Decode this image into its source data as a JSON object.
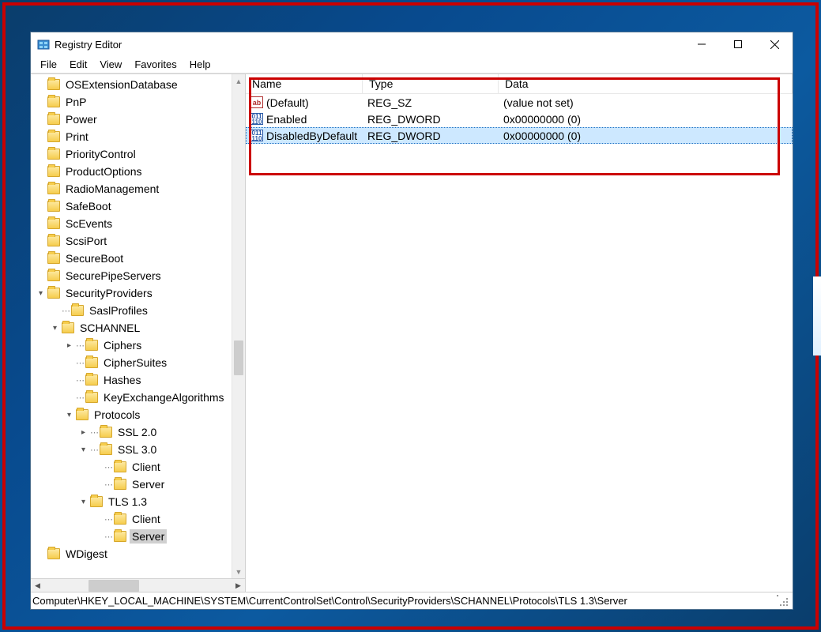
{
  "window": {
    "title": "Registry Editor"
  },
  "menu": {
    "file": "File",
    "edit": "Edit",
    "view": "View",
    "favorites": "Favorites",
    "help": "Help"
  },
  "tree": {
    "items": [
      {
        "indent": 0,
        "caret": "",
        "name": "OSExtensionDatabase"
      },
      {
        "indent": 0,
        "caret": "",
        "name": "PnP"
      },
      {
        "indent": 0,
        "caret": "",
        "name": "Power"
      },
      {
        "indent": 0,
        "caret": "",
        "name": "Print"
      },
      {
        "indent": 0,
        "caret": "",
        "name": "PriorityControl"
      },
      {
        "indent": 0,
        "caret": "",
        "name": "ProductOptions"
      },
      {
        "indent": 0,
        "caret": "",
        "name": "RadioManagement"
      },
      {
        "indent": 0,
        "caret": "",
        "name": "SafeBoot"
      },
      {
        "indent": 0,
        "caret": "",
        "name": "ScEvents"
      },
      {
        "indent": 0,
        "caret": "",
        "name": "ScsiPort"
      },
      {
        "indent": 0,
        "caret": "",
        "name": "SecureBoot"
      },
      {
        "indent": 0,
        "caret": "",
        "name": "SecurePipeServers"
      },
      {
        "indent": 0,
        "caret": "v",
        "name": "SecurityProviders"
      },
      {
        "indent": 1,
        "caret": "",
        "dots": true,
        "name": "SaslProfiles"
      },
      {
        "indent": 1,
        "caret": "v",
        "name": "SCHANNEL"
      },
      {
        "indent": 2,
        "caret": ">",
        "dots": true,
        "name": "Ciphers"
      },
      {
        "indent": 2,
        "caret": "",
        "dots": true,
        "name": "CipherSuites"
      },
      {
        "indent": 2,
        "caret": "",
        "dots": true,
        "name": "Hashes"
      },
      {
        "indent": 2,
        "caret": "",
        "dots": true,
        "name": "KeyExchangeAlgorithms"
      },
      {
        "indent": 2,
        "caret": "v",
        "name": "Protocols"
      },
      {
        "indent": 3,
        "caret": ">",
        "dots": true,
        "name": "SSL 2.0"
      },
      {
        "indent": 3,
        "caret": "v",
        "dots": true,
        "name": "SSL 3.0"
      },
      {
        "indent": 4,
        "caret": "",
        "dots": true,
        "name": "Client"
      },
      {
        "indent": 4,
        "caret": "",
        "dots": true,
        "name": "Server"
      },
      {
        "indent": 3,
        "caret": "v",
        "name": "TLS 1.3"
      },
      {
        "indent": 4,
        "caret": "",
        "dots": true,
        "name": "Client"
      },
      {
        "indent": 4,
        "caret": "",
        "dots": true,
        "name": "Server",
        "selected": true
      },
      {
        "indent": 0,
        "caret": "",
        "name": "WDigest"
      }
    ]
  },
  "list": {
    "columns": {
      "name": "Name",
      "type": "Type",
      "data": "Data"
    },
    "rows": [
      {
        "icon": "ab",
        "name": "(Default)",
        "type": "REG_SZ",
        "data": "(value not set)"
      },
      {
        "icon": "bin",
        "name": "Enabled",
        "type": "REG_DWORD",
        "data": "0x00000000 (0)"
      },
      {
        "icon": "bin",
        "name": "DisabledByDefault",
        "type": "REG_DWORD",
        "data": "0x00000000 (0)",
        "selected": true
      }
    ]
  },
  "status": {
    "path": "Computer\\HKEY_LOCAL_MACHINE\\SYSTEM\\CurrentControlSet\\Control\\SecurityProviders\\SCHANNEL\\Protocols\\TLS 1.3\\Server"
  }
}
